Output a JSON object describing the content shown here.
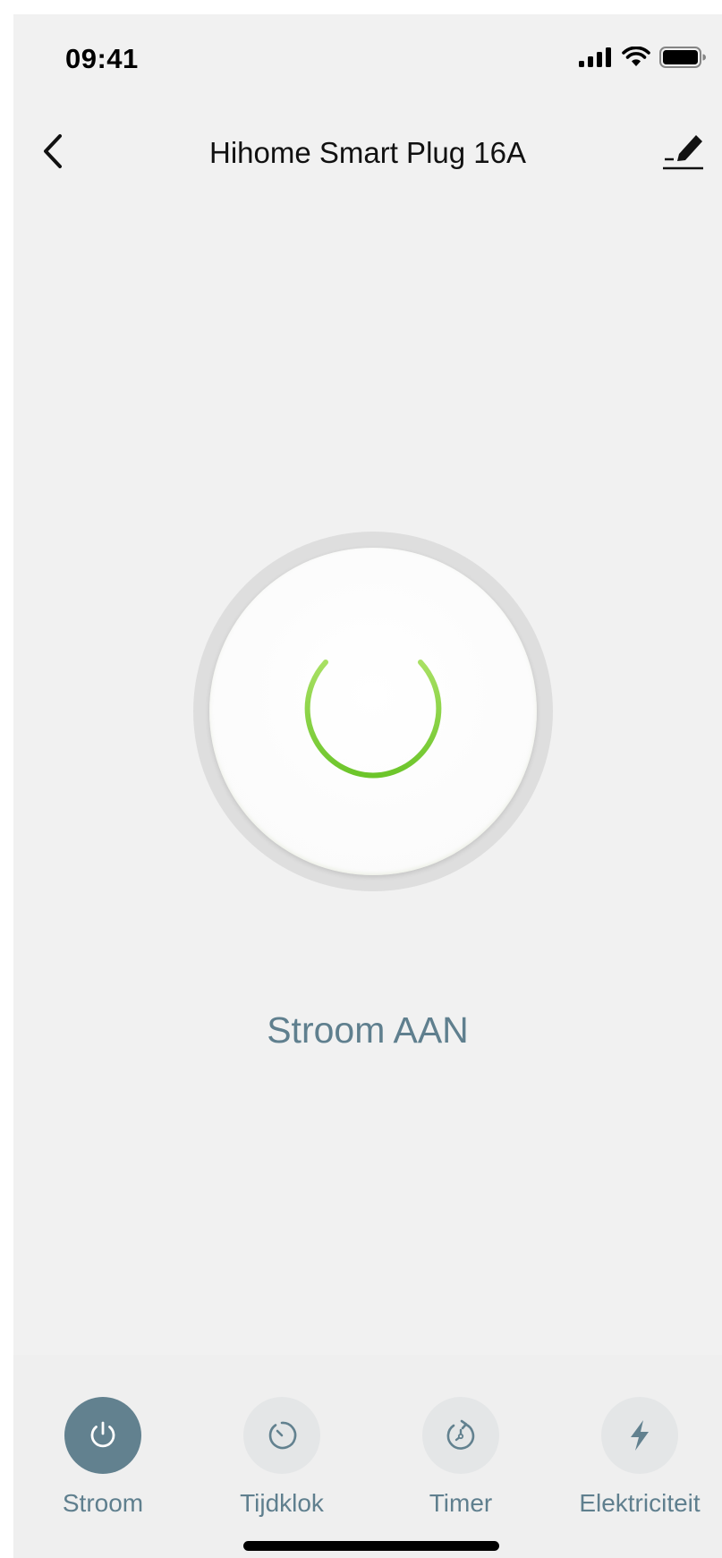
{
  "status_bar": {
    "time": "09:41"
  },
  "header": {
    "title": "Hihome Smart Plug 16A",
    "back_icon": "chevron-left-icon",
    "edit_icon": "edit-pencil-icon"
  },
  "device": {
    "status_text": "Stroom AAN",
    "power_on": true,
    "power_color": "#7ed321"
  },
  "tabs": [
    {
      "label": "Stroom",
      "icon": "power-icon",
      "active": true
    },
    {
      "label": "Tijdklok",
      "icon": "clock-icon",
      "active": false
    },
    {
      "label": "Timer",
      "icon": "timer-icon",
      "active": false
    },
    {
      "label": "Elektriciteit",
      "icon": "lightning-icon",
      "active": false
    }
  ],
  "colors": {
    "accent": "#62818f",
    "label": "#5f7f8e",
    "background": "#f1f1f1"
  }
}
